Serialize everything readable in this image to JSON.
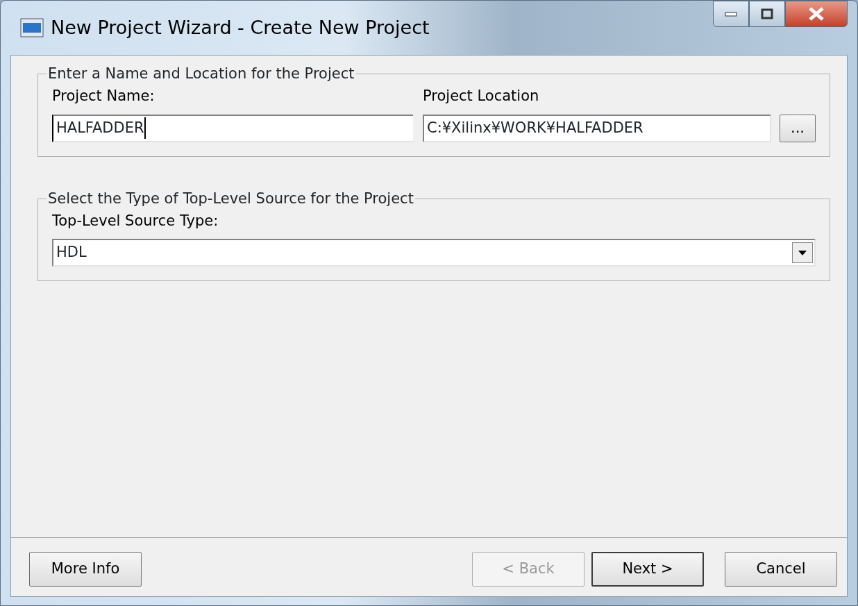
{
  "window": {
    "title": "New Project Wizard - Create New Project"
  },
  "window_controls": [
    {
      "kind": "minimize"
    },
    {
      "kind": "maximize"
    },
    {
      "kind": "close"
    }
  ],
  "name_group": {
    "title": "Enter a Name and Location for the Project",
    "project_name": {
      "label": "Project Name:",
      "value": "HALFADDER",
      "focused": true
    },
    "project_location": {
      "label": "Project Location",
      "value": "C:¥Xilinx¥WORK¥HALFADDER"
    },
    "browse_button": "..."
  },
  "source_group": {
    "title": "Select the Type of Top-Level Source for the Project",
    "label": "Top-Level Source Type:",
    "value": "HDL"
  },
  "buttons": [
    {
      "label": "More Info",
      "disabled": false,
      "default": false
    },
    {
      "label": "< Back",
      "disabled": true,
      "default": false
    },
    {
      "label": "Next >",
      "disabled": false,
      "default": true
    },
    {
      "label": "Cancel",
      "disabled": false,
      "default": false
    }
  ]
}
